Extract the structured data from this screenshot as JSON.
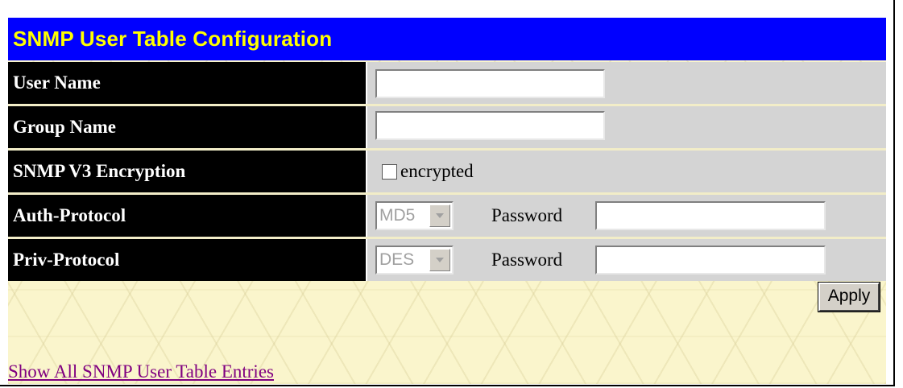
{
  "title": "SNMP User Table Configuration",
  "colors": {
    "header_bg": "#0000ff",
    "header_text": "#ffff00",
    "label_bg": "#000000",
    "value_bg": "#d4d4d4",
    "link": "#800080"
  },
  "form": {
    "user_name": {
      "label": "User Name",
      "value": ""
    },
    "group_name": {
      "label": "Group Name",
      "value": ""
    },
    "encryption": {
      "label": "SNMP V3 Encryption",
      "checkbox_label": "encrypted",
      "checked": false
    },
    "auth_protocol": {
      "label": "Auth-Protocol",
      "selected": "MD5",
      "password_label": "Password",
      "password_value": ""
    },
    "priv_protocol": {
      "label": "Priv-Protocol",
      "selected": "DES",
      "password_label": "Password",
      "password_value": ""
    }
  },
  "apply_label": "Apply",
  "show_all_link": "Show All SNMP User Table Entries"
}
